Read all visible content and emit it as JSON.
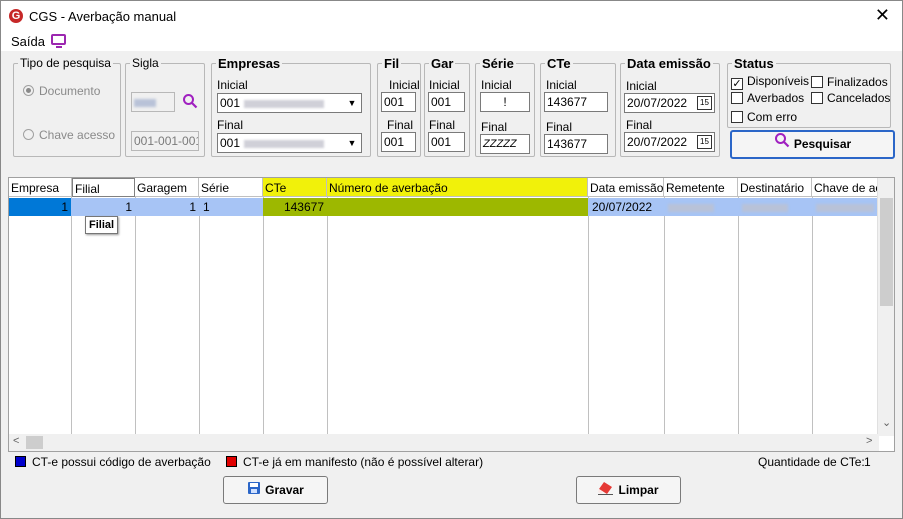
{
  "window": {
    "title": "CGS - Averbação manual",
    "logo_letter": "G"
  },
  "menu": {
    "saida": "Saída"
  },
  "tipo_pesquisa": {
    "legend": "Tipo de pesquisa",
    "options": [
      "Documento",
      "Chave acesso"
    ]
  },
  "sigla": {
    "legend": "Sigla",
    "value2": "001-001-001"
  },
  "empresas": {
    "legend": "Empresas",
    "inicial_label": "Inicial",
    "inicial_value": "001",
    "final_label": "Final",
    "final_value": "001"
  },
  "fil": {
    "legend": "Fil",
    "inicial_label": "Inicial",
    "inicial_value": "001",
    "final_label": "Final",
    "final_value": "001"
  },
  "gar": {
    "legend": "Gar",
    "inicial_label": "Inicial",
    "inicial_value": "001",
    "final_label": "Final",
    "final_value": "001"
  },
  "serie": {
    "legend": "Série",
    "inicial_label": "Inicial",
    "inicial_value": "!",
    "final_label": "Final",
    "final_value": "ZZZZZ"
  },
  "cte": {
    "legend": "CTe",
    "inicial_label": "Inicial",
    "inicial_value": "143677",
    "final_label": "Final",
    "final_value": "143677"
  },
  "data_emissao": {
    "legend": "Data emissão",
    "inicial_label": "Inicial",
    "inicial_value": "20/07/2022",
    "final_label": "Final",
    "final_value": "20/07/2022",
    "cal_icon": "15"
  },
  "status": {
    "legend": "Status",
    "disponiveis": "Disponíveis",
    "finalizados": "Finalizados",
    "averbados": "Averbados",
    "cancelados": "Cancelados",
    "com_erro": "Com erro",
    "check_mark": "✓"
  },
  "buttons": {
    "pesquisar": "Pesquisar",
    "gravar": "Gravar",
    "limpar": "Limpar"
  },
  "grid": {
    "columns": [
      "Empresa",
      "Filial",
      "Garagem",
      "Série",
      "CTe",
      "Número de averbação",
      "Data emissão",
      "Remetente",
      "Destinatário",
      "Chave de ac"
    ],
    "row": {
      "empresa": "1",
      "filial": "1",
      "garagem": "1",
      "serie": "1",
      "cte": "143677",
      "numero_averbacao": "",
      "data_emissao": "20/07/2022"
    },
    "tooltip": "Filial"
  },
  "footer": {
    "legend_blue": "CT-e possui código de averbação",
    "legend_red": "CT-e já em manifesto (não é possível alterar)",
    "quantidade_label": "Quantidade de CTe:",
    "quantidade_value": "1"
  },
  "colors": {
    "blue_legend": "#0000cc",
    "red_legend": "#e00000",
    "highlight_yellow": "#f1f10a",
    "row_green": "#9db800",
    "row_blue": "#a7c4f5"
  },
  "scroll": {
    "left": "<",
    "right": ">",
    "down": "⌄"
  }
}
